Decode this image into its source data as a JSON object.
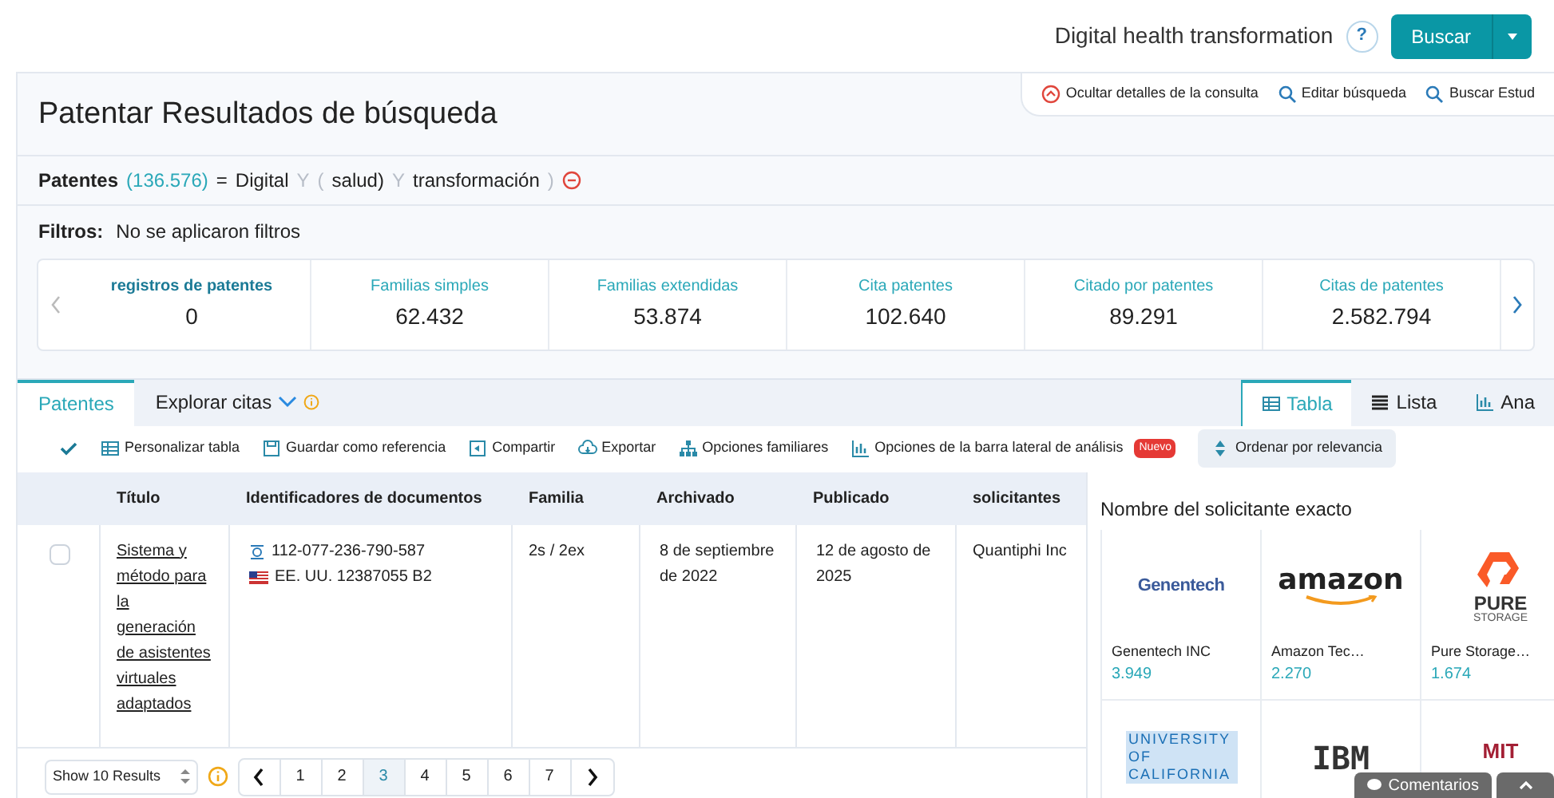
{
  "search": {
    "query": "Digital health transformation",
    "help": "?",
    "button": "Buscar"
  },
  "page": {
    "title": "Patentar Resultados de búsqueda",
    "links": [
      {
        "kind": "hide",
        "label": "Ocultar detalles de la consulta"
      },
      {
        "kind": "search",
        "label": "Editar búsqueda"
      },
      {
        "kind": "search",
        "label": "Buscar Estud"
      }
    ]
  },
  "query": {
    "label": "Patentes",
    "count": "(136.576)",
    "equals": "=",
    "parts": [
      {
        "kind": "term",
        "text": "Digital"
      },
      {
        "kind": "op",
        "text": "Y"
      },
      {
        "kind": "op",
        "text": "("
      },
      {
        "kind": "term",
        "text": "salud)"
      },
      {
        "kind": "op",
        "text": "Y"
      },
      {
        "kind": "term",
        "text": "transformación"
      },
      {
        "kind": "op",
        "text": ")"
      }
    ]
  },
  "filters": {
    "label": "Filtros:",
    "value": "No se aplicaron filtros"
  },
  "stats": [
    {
      "label": "registros de patentes",
      "value": "0",
      "selected": true
    },
    {
      "label": "Familias simples",
      "value": "62.432",
      "selected": false
    },
    {
      "label": "Familias extendidas",
      "value": "53.874",
      "selected": false
    },
    {
      "label": "Cita patentes",
      "value": "102.640",
      "selected": false
    },
    {
      "label": "Citado por patentes",
      "value": "89.291",
      "selected": false
    },
    {
      "label": "Citas de patentes",
      "value": "2.582.794",
      "selected": false
    }
  ],
  "tabs": [
    {
      "label": "Patentes",
      "selected": true
    },
    {
      "label": "Explorar citas",
      "selected": false
    }
  ],
  "view_tabs": [
    {
      "kind": "table",
      "label": "Tabla",
      "selected": true
    },
    {
      "kind": "list",
      "label": "Lista",
      "selected": false
    },
    {
      "kind": "chart",
      "label": "Ana",
      "selected": false
    }
  ],
  "toolbar": [
    {
      "kind": "table",
      "label": "Personalizar tabla"
    },
    {
      "kind": "save",
      "label": "Guardar como referencia"
    },
    {
      "kind": "share",
      "label": "Compartir"
    },
    {
      "kind": "export",
      "label": "Exportar"
    },
    {
      "kind": "family",
      "label": "Opciones familiares"
    },
    {
      "kind": "chart",
      "label": "Opciones de la barra lateral de análisis",
      "badge": "Nuevo"
    },
    {
      "kind": "sort",
      "label": "Ordenar por relevancia"
    }
  ],
  "table": {
    "columns": [
      "Título",
      "Identificadores de documentos",
      "Familia",
      "Archivado",
      "Publicado",
      "solicitantes"
    ],
    "rows": [
      {
        "checked": false,
        "title": "Sistema y método para la generación de asistentes virtuales adaptados",
        "lens_id": "112-077-236-790-587",
        "doc": "EE. UU. 12387055 B2",
        "family": "2s / 2ex",
        "filed": "8 de septiembre de 2022",
        "published": "12 de agosto de 2025",
        "applicants": "Quantiphi Inc"
      }
    ]
  },
  "pagination": {
    "page_size": "Show 10 Results",
    "pages": [
      {
        "label": "1",
        "selected": false
      },
      {
        "label": "2",
        "selected": false
      },
      {
        "label": "3",
        "selected": true
      },
      {
        "label": "4",
        "selected": false
      },
      {
        "label": "5",
        "selected": false
      },
      {
        "label": "6",
        "selected": false
      },
      {
        "label": "7",
        "selected": false
      }
    ]
  },
  "applicants": {
    "title": "Nombre del solicitante exacto",
    "items": [
      {
        "kind": "genentech",
        "logo": "Genentech",
        "name": "Genentech INC",
        "count": "3.949"
      },
      {
        "kind": "amazon",
        "logo": "amazon",
        "name": "Amazon Tec…",
        "count": "2.270"
      },
      {
        "kind": "pure",
        "logo": "PURE",
        "logo_sub": "STORAGE",
        "name": "Pure Storage…",
        "count": "1.674"
      },
      {
        "kind": "uc",
        "logo": "UNIVERSITY OF CALIFORNIA"
      },
      {
        "kind": "ibm",
        "logo": "IBM"
      },
      {
        "kind": "mit",
        "logo": "MIT"
      }
    ]
  },
  "feedback": "Comentarios"
}
